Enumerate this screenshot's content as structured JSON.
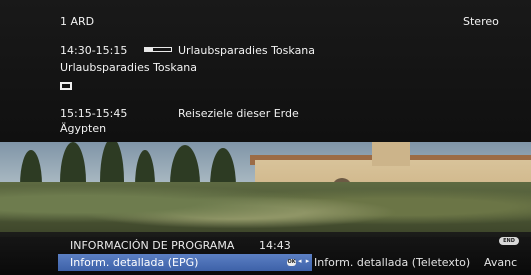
{
  "channel": {
    "number_name": "1 ARD",
    "audio": "Stereo"
  },
  "current_program": {
    "time": "14:30-15:15",
    "title": "Urlaubsparadies Toskana",
    "subtitle": "Urlaubsparadies Toskana",
    "progress_fraction": 0.3
  },
  "next_program": {
    "time": "15:15-15:45",
    "title": "Reiseziele dieser Erde",
    "subtitle": "Ägypten"
  },
  "menu": {
    "title": "INFORMACIÓN DE PROGRAMA",
    "time": "14:43",
    "end_badge": "END",
    "ok_label": "OK",
    "arrows": "◂ ▸",
    "items": [
      "Inform. detallada (EPG)",
      "Inform. detallada (Teletexto)",
      "Avanc"
    ]
  }
}
